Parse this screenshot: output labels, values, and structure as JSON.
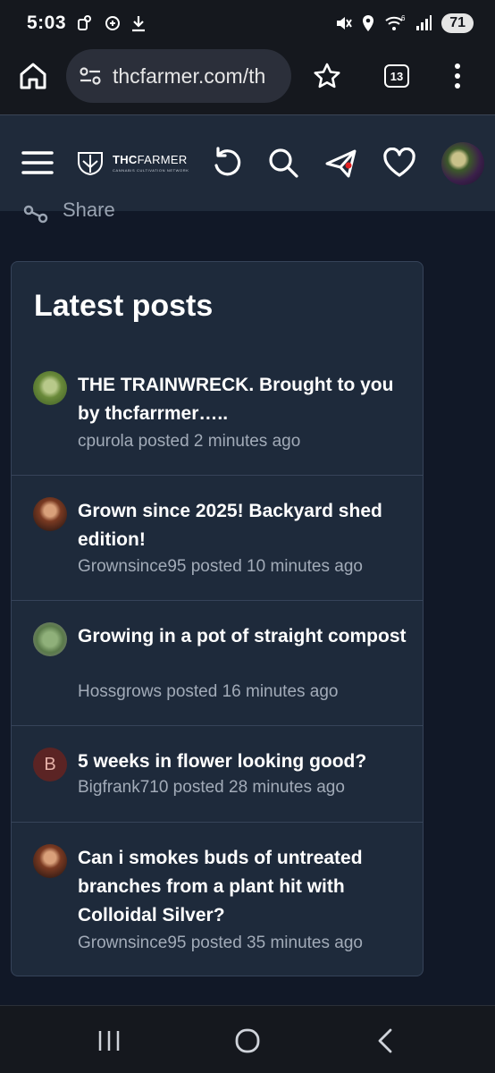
{
  "status_bar": {
    "time": "5:03",
    "battery": "71",
    "left_icons": [
      "nfc-icon",
      "data-saver-icon",
      "download-icon"
    ],
    "right_icons": [
      "mute-icon",
      "location-icon",
      "wifi-6-icon",
      "signal-icon"
    ]
  },
  "browser": {
    "url": "thcfarmer.com/th",
    "tab_count": "13"
  },
  "site_header": {
    "logo_main_bold": "THC",
    "logo_main_thin": "FARMER",
    "logo_sub": "CANNABIS CULTIVATION NETWORK"
  },
  "share": {
    "label": "Share"
  },
  "latest_posts": {
    "title": "Latest posts",
    "posts": [
      {
        "title": "THE TRAINWRECK. Brought to you by thcfarrmer…..",
        "meta": "cpurola posted 2 minutes ago",
        "avatar": "avatar-image"
      },
      {
        "title": "Grown since 2025! Backyard shed edition!",
        "meta": "Grownsince95 posted 10 minutes ago",
        "avatar": "avatar-image"
      },
      {
        "title": "Growing in a pot of straight compost",
        "meta": "Hossgrows posted 16 minutes ago",
        "avatar": "avatar-image"
      },
      {
        "title": "5 weeks in flower looking good?",
        "meta": "Bigfrank710 posted 28 minutes ago",
        "avatar_letter": "B"
      },
      {
        "title": "Can i smokes buds of untreated branches from a plant hit with Colloidal Silver?",
        "meta": "Grownsince95 posted 35 minutes ago",
        "avatar": "avatar-image"
      }
    ]
  },
  "colors": {
    "page_bg": "#111827",
    "header_bg": "#1f2a3a",
    "card_bg": "#1e2a3b",
    "meta_text": "#a2abb8",
    "letter_avatar_bg": "#5b2424"
  }
}
